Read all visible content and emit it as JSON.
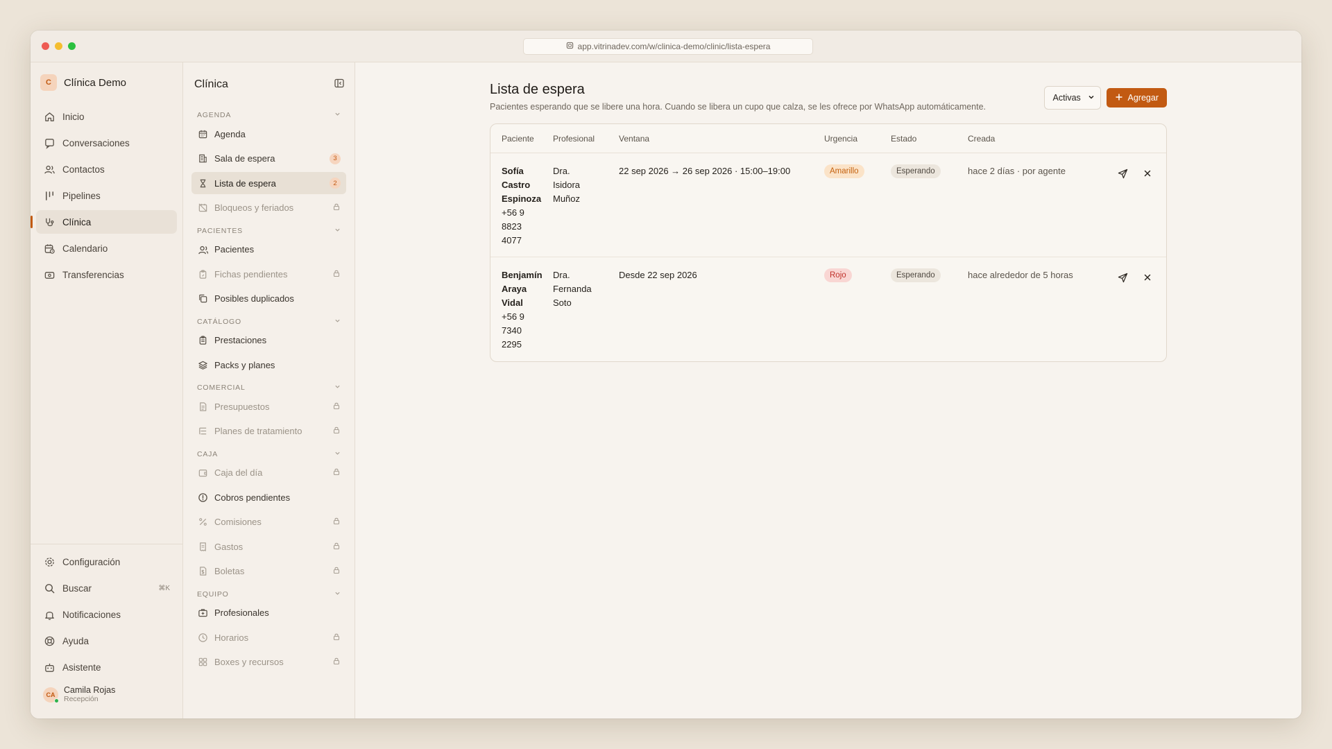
{
  "browser": {
    "url": "app.vitrinadev.com/w/clinica-demo/clinic/lista-espera"
  },
  "workspace": {
    "initial": "C",
    "name": "Clínica Demo"
  },
  "nav": [
    {
      "label": "Inicio",
      "icon": "home-icon"
    },
    {
      "label": "Conversaciones",
      "icon": "chat-icon"
    },
    {
      "label": "Contactos",
      "icon": "users-icon"
    },
    {
      "label": "Pipelines",
      "icon": "pipeline-icon"
    },
    {
      "label": "Clínica",
      "icon": "stethoscope-icon",
      "active": true
    },
    {
      "label": "Calendario",
      "icon": "calendar-clock-icon"
    },
    {
      "label": "Transferencias",
      "icon": "transfer-icon"
    }
  ],
  "nav_bottom": [
    {
      "label": "Configuración",
      "icon": "gear-icon"
    },
    {
      "label": "Buscar",
      "icon": "search-icon",
      "shortcut": "⌘K"
    },
    {
      "label": "Notificaciones",
      "icon": "bell-icon"
    },
    {
      "label": "Ayuda",
      "icon": "lifebuoy-icon"
    },
    {
      "label": "Asistente",
      "icon": "bot-icon"
    }
  ],
  "user": {
    "initials": "CA",
    "name": "Camila Rojas",
    "role": "Recepción"
  },
  "clinic_nav": {
    "title": "Clínica",
    "sections": [
      {
        "title": "AGENDA",
        "items": [
          {
            "label": "Agenda",
            "icon": "calendar-icon"
          },
          {
            "label": "Sala de espera",
            "icon": "building-icon",
            "badge": "3"
          },
          {
            "label": "Lista de espera",
            "icon": "hourglass-icon",
            "badge": "2",
            "active": true
          },
          {
            "label": "Bloqueos y feriados",
            "icon": "calendar-off-icon",
            "locked": true
          }
        ]
      },
      {
        "title": "PACIENTES",
        "items": [
          {
            "label": "Pacientes",
            "icon": "users-icon"
          },
          {
            "label": "Fichas pendientes",
            "icon": "clipboard-icon",
            "locked": true
          },
          {
            "label": "Posibles duplicados",
            "icon": "copy-icon"
          }
        ]
      },
      {
        "title": "CATÁLOGO",
        "items": [
          {
            "label": "Prestaciones",
            "icon": "clipboard-list-icon"
          },
          {
            "label": "Packs y planes",
            "icon": "layers-icon"
          }
        ]
      },
      {
        "title": "COMERCIAL",
        "items": [
          {
            "label": "Presupuestos",
            "icon": "document-icon",
            "locked": true
          },
          {
            "label": "Planes de tratamiento",
            "icon": "list-tree-icon",
            "locked": true
          }
        ]
      },
      {
        "title": "CAJA",
        "items": [
          {
            "label": "Caja del día",
            "icon": "wallet-icon",
            "locked": true
          },
          {
            "label": "Cobros pendientes",
            "icon": "alert-circle-icon"
          },
          {
            "label": "Comisiones",
            "icon": "percent-icon",
            "locked": true
          },
          {
            "label": "Gastos",
            "icon": "receipt-icon",
            "locked": true
          },
          {
            "label": "Boletas",
            "icon": "file-dollar-icon",
            "locked": true
          }
        ]
      },
      {
        "title": "EQUIPO",
        "items": [
          {
            "label": "Profesionales",
            "icon": "briefcase-medical-icon"
          },
          {
            "label": "Horarios",
            "icon": "clock-icon",
            "locked": true
          },
          {
            "label": "Boxes y recursos",
            "icon": "grid-icon",
            "locked": true
          }
        ]
      }
    ]
  },
  "page": {
    "title": "Lista de espera",
    "subtitle": "Pacientes esperando que se libere una hora. Cuando se libera un cupo que calza, se les ofrece por WhatsApp automáticamente.",
    "filter_value": "Activas",
    "add_label": "Agregar"
  },
  "table": {
    "headers": [
      "Paciente",
      "Profesional",
      "Ventana",
      "Urgencia",
      "Estado",
      "Creada"
    ],
    "rows": [
      {
        "patient": [
          "Sofía",
          "Castro",
          "Espinoza"
        ],
        "phone": [
          "+56 9",
          "8823",
          "4077"
        ],
        "professional": [
          "Dra.",
          "Isidora",
          "Muñoz"
        ],
        "window": "22 sep 2026 → 26 sep 2026 · 15:00–19:00",
        "urgency": "Amarillo",
        "urgency_color": "#c4620f",
        "status": "Esperando",
        "created": "hace 2 días · por agente"
      },
      {
        "patient": [
          "Benjamín",
          "Araya",
          "Vidal"
        ],
        "phone": [
          "+56 9",
          "7340",
          "2295"
        ],
        "professional": [
          "Dra.",
          "Fernanda",
          "Soto"
        ],
        "window": "Desde 22 sep 2026",
        "urgency": "Rojo",
        "urgency_color": "#c0312a",
        "status": "Esperando",
        "created": "hace alrededor de 5 horas"
      }
    ]
  },
  "colors": {
    "accent": "#c25a12",
    "background": "#f7f3ee",
    "sidebar": "#f3ede6"
  }
}
